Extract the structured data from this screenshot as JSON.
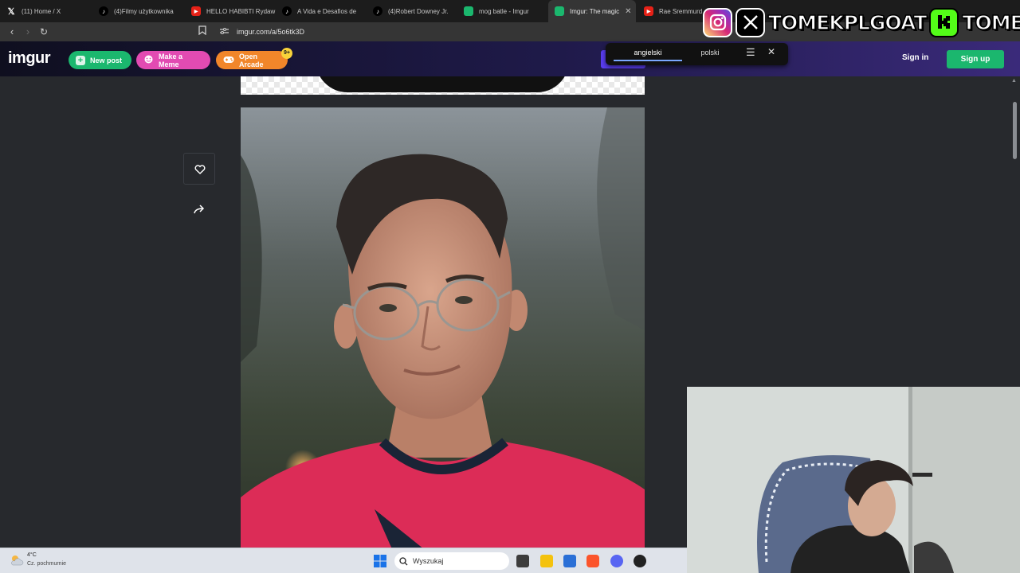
{
  "browser": {
    "tabs": [
      {
        "label": "(11) Home / X",
        "favicon": "x-icon"
      },
      {
        "label": "(4)Filmy użytkownika",
        "favicon": "tiktok-icon"
      },
      {
        "label": "HELLO HABIBTI Rydaw",
        "favicon": "youtube-icon"
      },
      {
        "label": "A Vida e Desafios de",
        "favicon": "tiktok-icon"
      },
      {
        "label": "(4)Robert Downey Jr.",
        "favicon": "tiktok-icon"
      },
      {
        "label": "mog batle - Imgur",
        "favicon": "imgur-icon"
      },
      {
        "label": "Imgur: The magic",
        "favicon": "imgur-icon",
        "active": true
      },
      {
        "label": "Rae Sremmurd, S",
        "favicon": "youtube-icon"
      }
    ],
    "url": "imgur.com/a/5o6tk3D"
  },
  "imgur": {
    "logo": "imgur",
    "new_post": "New post",
    "make_meme": "Make a Meme",
    "open_arcade": "Open Arcade",
    "arcade_badge": "9+",
    "sign_in": "Sign in",
    "sign_up": "Sign up",
    "colors": {
      "new_post": "#1bb76e",
      "make_meme": "#e24bb2",
      "open_arcade": "#f1862a",
      "sign_up": "#1bb76e"
    }
  },
  "translate_popup": {
    "lang_from": "angielski",
    "lang_to": "polski"
  },
  "overlay": {
    "handle_1": "TOMEKPLGOAT",
    "handle_2": "TOMEKPL",
    "icons": [
      "instagram-icon",
      "x-icon",
      "kick-icon"
    ]
  },
  "taskbar": {
    "temperature": "4°C",
    "weather": "Cz. pochmurnie",
    "search_placeholder": "Wyszukaj"
  }
}
